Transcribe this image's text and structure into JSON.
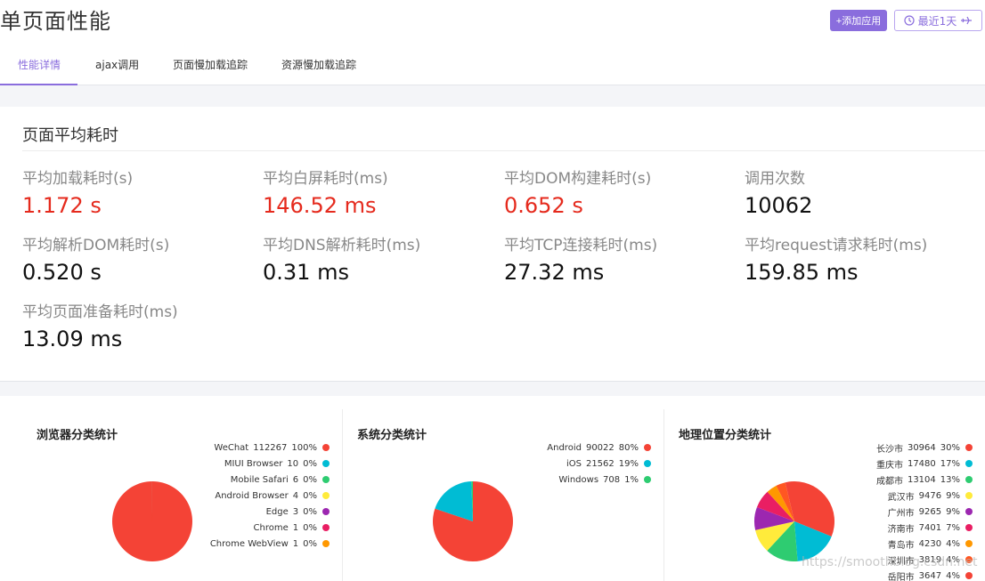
{
  "header": {
    "title": "单页面性能",
    "add_app_label": "+添加应用",
    "time_range_label": "最近1天"
  },
  "tabs": [
    {
      "label": "性能详情",
      "active": true
    },
    {
      "label": "ajax调用",
      "active": false
    },
    {
      "label": "页面慢加载追踪",
      "active": false
    },
    {
      "label": "资源慢加载追踪",
      "active": false
    }
  ],
  "perf": {
    "title": "页面平均耗时",
    "metrics": [
      {
        "label": "平均加载耗时(s)",
        "value": "1.172 s",
        "highlight": true
      },
      {
        "label": "平均白屏耗时(ms)",
        "value": "146.52 ms",
        "highlight": true
      },
      {
        "label": "平均DOM构建耗时(s)",
        "value": "0.652 s",
        "highlight": true
      },
      {
        "label": "调用次数",
        "value": "10062",
        "highlight": false
      },
      {
        "label": "平均解析DOM耗时(s)",
        "value": "0.520 s",
        "highlight": false
      },
      {
        "label": "平均DNS解析耗时(ms)",
        "value": "0.31 ms",
        "highlight": false
      },
      {
        "label": "平均TCP连接耗时(ms)",
        "value": "27.32 ms",
        "highlight": false
      },
      {
        "label": "平均request请求耗时(ms)",
        "value": "159.85 ms",
        "highlight": false
      },
      {
        "label": "平均页面准备耗时(ms)",
        "value": "13.09 ms",
        "highlight": false
      }
    ]
  },
  "colors": {
    "accent": "#8a6ddd",
    "highlight_value": "#e52a1d",
    "palette": [
      "#f44336",
      "#00bcd4",
      "#2ecc71",
      "#ffeb3b",
      "#9c27b0",
      "#e91e63",
      "#ff9800",
      "#ff5722"
    ]
  },
  "chart_data": [
    {
      "type": "pie",
      "title": "浏览器分类统计",
      "series": [
        {
          "name": "WeChat",
          "count": "112267",
          "pct": "100%",
          "value": 112267
        },
        {
          "name": "MIUI Browser",
          "count": "10",
          "pct": "0%",
          "value": 10
        },
        {
          "name": "Mobile Safari",
          "count": "6",
          "pct": "0%",
          "value": 6
        },
        {
          "name": "Android Browser",
          "count": "4",
          "pct": "0%",
          "value": 4
        },
        {
          "name": "Edge",
          "count": "3",
          "pct": "0%",
          "value": 3
        },
        {
          "name": "Chrome",
          "count": "1",
          "pct": "0%",
          "value": 1
        },
        {
          "name": "Chrome WebView",
          "count": "1",
          "pct": "0%",
          "value": 1
        }
      ],
      "colors": [
        "#f44336",
        "#00bcd4",
        "#2ecc71",
        "#ffeb3b",
        "#9c27b0",
        "#e91e63",
        "#ff9800"
      ]
    },
    {
      "type": "pie",
      "title": "系统分类统计",
      "series": [
        {
          "name": "Android",
          "count": "90022",
          "pct": "80%",
          "value": 90022
        },
        {
          "name": "iOS",
          "count": "21562",
          "pct": "19%",
          "value": 21562
        },
        {
          "name": "Windows",
          "count": "708",
          "pct": "1%",
          "value": 708
        }
      ],
      "colors": [
        "#f44336",
        "#00bcd4",
        "#2ecc71"
      ]
    },
    {
      "type": "pie",
      "title": "地理位置分类统计",
      "series": [
        {
          "name": "长沙市",
          "count": "30964",
          "pct": "30%",
          "value": 30964
        },
        {
          "name": "重庆市",
          "count": "17480",
          "pct": "17%",
          "value": 17480
        },
        {
          "name": "成都市",
          "count": "13104",
          "pct": "13%",
          "value": 13104
        },
        {
          "name": "武汉市",
          "count": "9476",
          "pct": "9%",
          "value": 9476
        },
        {
          "name": "广州市",
          "count": "9265",
          "pct": "9%",
          "value": 9265
        },
        {
          "name": "济南市",
          "count": "7401",
          "pct": "7%",
          "value": 7401
        },
        {
          "name": "青岛市",
          "count": "4230",
          "pct": "4%",
          "value": 4230
        },
        {
          "name": "深圳市",
          "count": "3819",
          "pct": "4%",
          "value": 3819
        },
        {
          "name": "岳阳市",
          "count": "3647",
          "pct": "4%",
          "value": 3647
        }
      ],
      "colors": [
        "#f44336",
        "#00bcd4",
        "#2ecc71",
        "#ffeb3b",
        "#9c27b0",
        "#e91e63",
        "#ff9800",
        "#ff5722",
        "#f44336"
      ]
    }
  ],
  "watermark": "https://smoothblog.csdn.net"
}
